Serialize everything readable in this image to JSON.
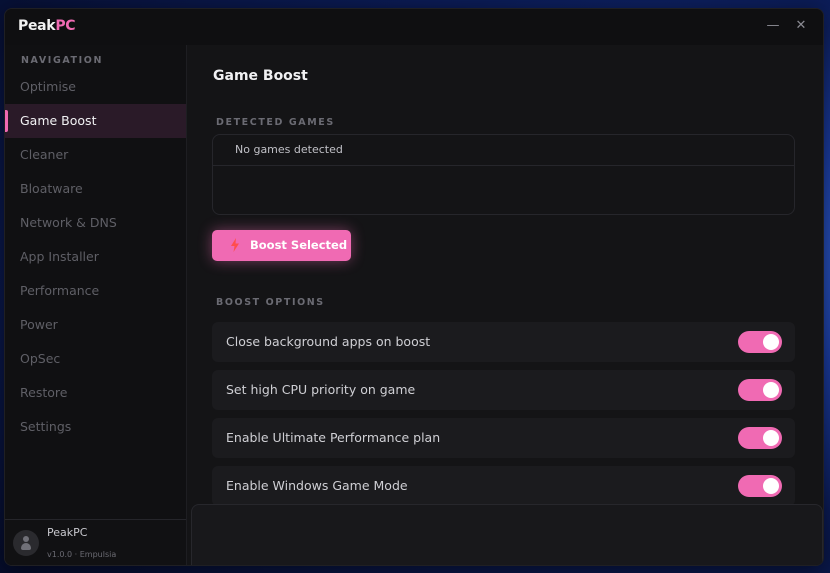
{
  "app": {
    "logo_peak": "Peak",
    "logo_pc": "PC",
    "minimize_label": "—",
    "close_label": "✕"
  },
  "sidebar": {
    "heading": "NAVIGATION",
    "items": [
      {
        "label": "Optimise"
      },
      {
        "label": "Game Boost"
      },
      {
        "label": "Cleaner"
      },
      {
        "label": "Bloatware"
      },
      {
        "label": "Network & DNS"
      },
      {
        "label": "App Installer"
      },
      {
        "label": "Performance"
      },
      {
        "label": "Power"
      },
      {
        "label": "OpSec"
      },
      {
        "label": "Restore"
      },
      {
        "label": "Settings"
      }
    ],
    "active_index": 1,
    "user": {
      "name": "PeakPC",
      "meta": "v1.0.0 · Empulsia"
    }
  },
  "main": {
    "title": "Game Boost",
    "detected_label": "DETECTED GAMES",
    "games_empty": "No games detected",
    "boost_button": "Boost Selected",
    "options_label": "BOOST OPTIONS",
    "options": [
      {
        "label": "Close background apps on boost",
        "enabled": true
      },
      {
        "label": "Set high CPU priority on game",
        "enabled": true
      },
      {
        "label": "Enable Ultimate Performance plan",
        "enabled": true
      },
      {
        "label": "Enable Windows Game Mode",
        "enabled": true
      }
    ]
  },
  "colors": {
    "accent": "#f06ab3",
    "window_bg": "#141416",
    "sidebar_bg": "#101012"
  },
  "icons": {
    "boost_button": "lightning-bolt-icon",
    "avatar": "user-avatar-icon"
  }
}
